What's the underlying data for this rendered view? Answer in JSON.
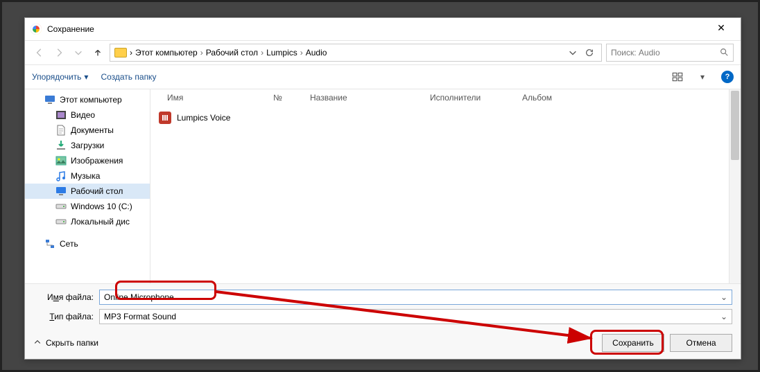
{
  "titlebar": {
    "title": "Сохранение"
  },
  "nav": {
    "breadcrumbs": [
      "Этот компьютер",
      "Рабочий стол",
      "Lumpics",
      "Audio"
    ],
    "search_placeholder": "Поиск: Audio"
  },
  "commands": {
    "organize": "Упорядочить",
    "new_folder": "Создать папку"
  },
  "sidebar": {
    "items": [
      {
        "label": "Этот компьютер",
        "icon": "monitor",
        "indent": 1,
        "selected": false
      },
      {
        "label": "Видео",
        "icon": "video",
        "indent": 2,
        "selected": false
      },
      {
        "label": "Документы",
        "icon": "doc",
        "indent": 2,
        "selected": false
      },
      {
        "label": "Загрузки",
        "icon": "download",
        "indent": 2,
        "selected": false
      },
      {
        "label": "Изображения",
        "icon": "image",
        "indent": 2,
        "selected": false
      },
      {
        "label": "Музыка",
        "icon": "music",
        "indent": 2,
        "selected": false
      },
      {
        "label": "Рабочий стол",
        "icon": "desktop",
        "indent": 2,
        "selected": true
      },
      {
        "label": "Windows 10 (C:)",
        "icon": "drive",
        "indent": 2,
        "selected": false
      },
      {
        "label": "Локальный дис",
        "icon": "drive",
        "indent": 2,
        "selected": false
      }
    ],
    "network_label": "Сеть"
  },
  "columns": {
    "name": "Имя",
    "track_no": "№",
    "title": "Название",
    "artists": "Исполнители",
    "album": "Альбом"
  },
  "files": [
    {
      "name": "Lumpics Voice"
    }
  ],
  "form": {
    "filename_label_pre": "И",
    "filename_label_ul": "м",
    "filename_label_post": "я файла:",
    "filetype_label_pre": "",
    "filetype_label_ul": "Т",
    "filetype_label_post": "ип файла:",
    "filename_value": "Online Microphone",
    "filetype_value": "MP3 Format Sound"
  },
  "footer": {
    "hide_folders": "Скрыть папки",
    "save": "Сохранить",
    "cancel": "Отмена"
  },
  "colors": {
    "highlight": "#c00"
  }
}
